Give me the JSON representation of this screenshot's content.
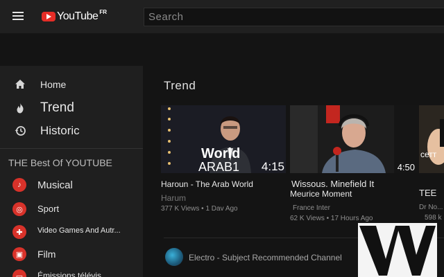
{
  "header": {
    "logo_text": "YouTube",
    "country_code": "FR",
    "search_placeholder": "Search"
  },
  "sidebar": {
    "nav": [
      {
        "label": "Home",
        "icon": "home-icon"
      },
      {
        "label": "Trend",
        "icon": "flame-icon"
      },
      {
        "label": "Historic",
        "icon": "history-icon"
      }
    ],
    "section_title": "THE Best Of YOUTUBE",
    "categories": [
      {
        "label": "Musical",
        "icon": "music-icon"
      },
      {
        "label": "Sport",
        "icon": "sport-icon"
      },
      {
        "label": "Video Games And Autr...",
        "icon": "gamepad-icon"
      },
      {
        "label": "Film",
        "icon": "film-icon"
      },
      {
        "label": "Émissions télévis",
        "icon": "tv-icon"
      }
    ]
  },
  "main": {
    "section_title": "Trend",
    "videos": [
      {
        "overlay_line1": "World",
        "overlay_line2": "ARAB1",
        "duration": "4:15",
        "title": "Haroun - The Arab World",
        "channel": "Harum",
        "meta": "377 K Views • 1 Dav Ago"
      },
      {
        "duration": "4:50",
        "title": "Wissous. Minefield It",
        "title2": "Meurice Moment",
        "channel": "France Inter",
        "meta": "62 K Views • 17 Hours Ago"
      },
      {
        "overlay": "сетт",
        "title": "TEE",
        "channel": "Dr No...",
        "meta": "598 k"
      }
    ],
    "channel_row": "Electro - Subject Recommended Channel"
  },
  "watermark": {
    "text": "VV"
  },
  "colors": {
    "accent": "#d8322a",
    "topbar": "#202020",
    "sidebar": "#1f1f1f",
    "background": "#141414"
  }
}
